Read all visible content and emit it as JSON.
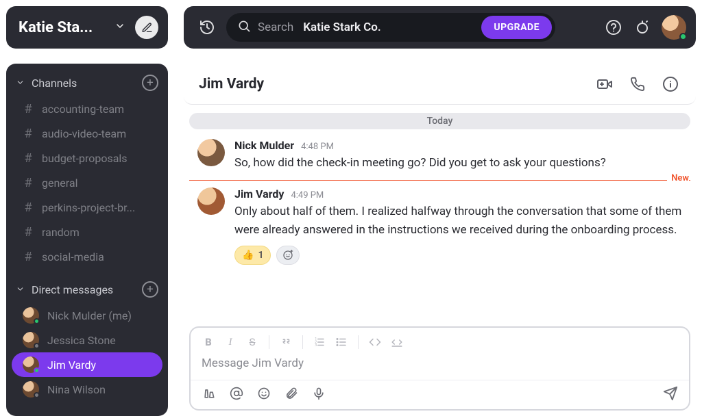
{
  "workspace": {
    "name_truncated": "Katie Sta..."
  },
  "topbar": {
    "search_label": "Search",
    "search_context": "Katie Stark Co.",
    "upgrade_label": "UPGRADE"
  },
  "sidebar": {
    "channels_header": "Channels",
    "channels": [
      {
        "name": "accounting-team"
      },
      {
        "name": "audio-video-team"
      },
      {
        "name": "budget-proposals"
      },
      {
        "name": "general"
      },
      {
        "name": "perkins-project-br..."
      },
      {
        "name": "random"
      },
      {
        "name": "social-media"
      }
    ],
    "dms_header": "Direct messages",
    "dms": [
      {
        "name": "Nick Mulder (me)",
        "presence": "online",
        "active": false
      },
      {
        "name": "Jessica Stone",
        "presence": "offline",
        "active": false
      },
      {
        "name": "Jim Vardy",
        "presence": "online",
        "active": true
      },
      {
        "name": "Nina Wilson",
        "presence": "offline",
        "active": false
      }
    ]
  },
  "chat": {
    "title": "Jim Vardy",
    "date_label": "Today",
    "new_divider_label": "New",
    "messages": [
      {
        "author": "Nick Mulder",
        "time": "4:48 PM",
        "text": "So, how did the check-in meeting go? Did you get to ask your questions?"
      },
      {
        "author": "Jim Vardy",
        "time": "4:49 PM",
        "text": "Only about half of them. I realized halfway through the conversation that some of them were already answered in the instructions we received during the onboarding process.",
        "reactions": [
          {
            "emoji": "👍",
            "count": "1"
          }
        ]
      }
    ],
    "composer_placeholder": "Message Jim Vardy"
  }
}
